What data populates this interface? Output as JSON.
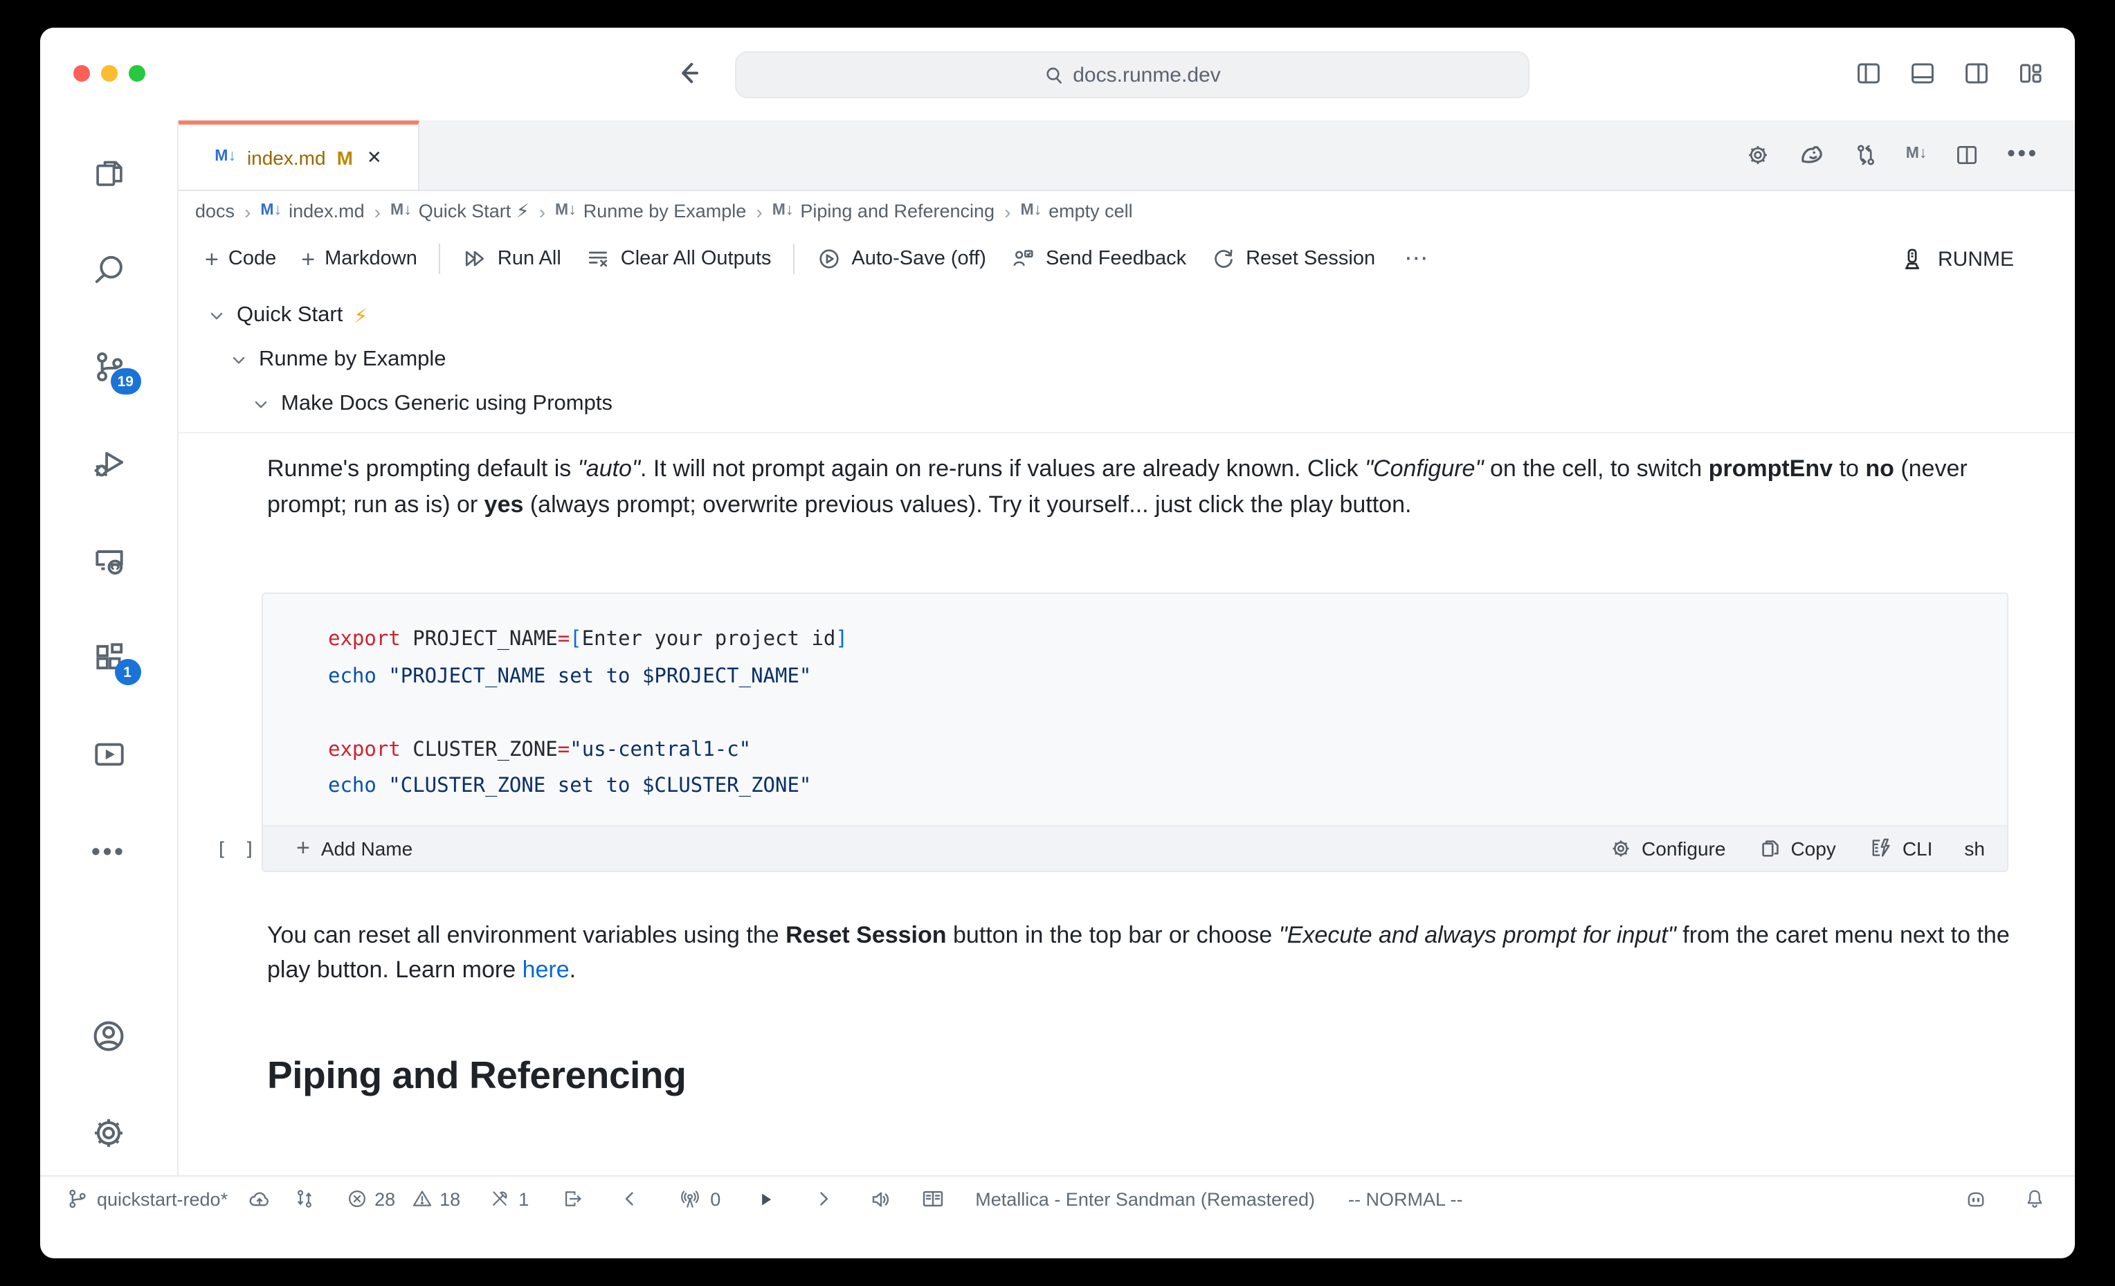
{
  "colors": {
    "tab_accent": "#F4806C",
    "badge_blue": "#1A73D9",
    "link_blue": "#0969DA",
    "code_keyword_red": "#CF222E",
    "code_string_navy": "#0A3069",
    "code_builtin_blue": "#0550AE",
    "modified_file_yellow": "#9A6700",
    "traffic_red": "#FF5F57",
    "traffic_yellow": "#FEBC2E",
    "traffic_green": "#28C840"
  },
  "titlebar": {
    "address": "docs.runme.dev"
  },
  "activity_bar": {
    "scm_badge": "19",
    "extensions_badge": "1"
  },
  "tab": {
    "title": "index.md",
    "modified": "M",
    "close": "✕"
  },
  "breadcrumb": {
    "root": "docs",
    "items": [
      "index.md",
      "Quick Start ⚡",
      "Runme by Example",
      "Piping and Referencing",
      "empty cell"
    ]
  },
  "toolbar": {
    "code": "Code",
    "markdown": "Markdown",
    "run_all": "Run All",
    "clear_all": "Clear All Outputs",
    "auto_save": "Auto-Save (off)",
    "send_feedback": "Send Feedback",
    "reset_session": "Reset Session",
    "more": "⋯",
    "runme": "RUNME"
  },
  "outline": [
    {
      "label": "Quick Start",
      "suffix": "⚡"
    },
    {
      "label": "Runme by Example",
      "suffix": ""
    },
    {
      "label": "Make Docs Generic using Prompts",
      "suffix": ""
    }
  ],
  "doc": {
    "p1": [
      "Runme's prompting default is ",
      "\"auto\"",
      ". It will not prompt again on re-runs if values are already known. Click ",
      "\"Configure\"",
      " on the cell, to switch ",
      "promptEnv",
      " to ",
      "no",
      " (never prompt; run as is) or ",
      "yes",
      " (always prompt; overwrite previous values). Try it yourself... just click the play button."
    ],
    "p2": [
      "You can reset all environment variables using the ",
      "Reset Session",
      " button in the top bar or choose ",
      "\"Execute and always prompt for input\"",
      " from the caret menu next to the play button. Learn more ",
      "here",
      "."
    ],
    "heading": "Piping and Referencing"
  },
  "code": {
    "l1": {
      "kw": "export",
      "name": " PROJECT_NAME",
      "eq": "=",
      "ob": "[",
      "inner": "Enter your project id",
      "cb": "]"
    },
    "l2": {
      "cmd": "echo",
      "str": " \"PROJECT_NAME set to $PROJECT_NAME\""
    },
    "l4": {
      "kw": "export",
      "name": " CLUSTER_ZONE",
      "eq": "=",
      "str": "\"us-central1-c\""
    },
    "l5": {
      "cmd": "echo",
      "str": " \"CLUSTER_ZONE set to $CLUSTER_ZONE\""
    }
  },
  "cell": {
    "gutter": "[ ]",
    "add_name": "Add Name",
    "configure": "Configure",
    "copy": "Copy",
    "cli": "CLI",
    "lang": "sh"
  },
  "status": {
    "branch": "quickstart-redo*",
    "errors": "28",
    "warnings": "18",
    "tasks": "1",
    "radio": "0",
    "song": "Metallica - Enter Sandman (Remastered)",
    "mode": "-- NORMAL --"
  }
}
